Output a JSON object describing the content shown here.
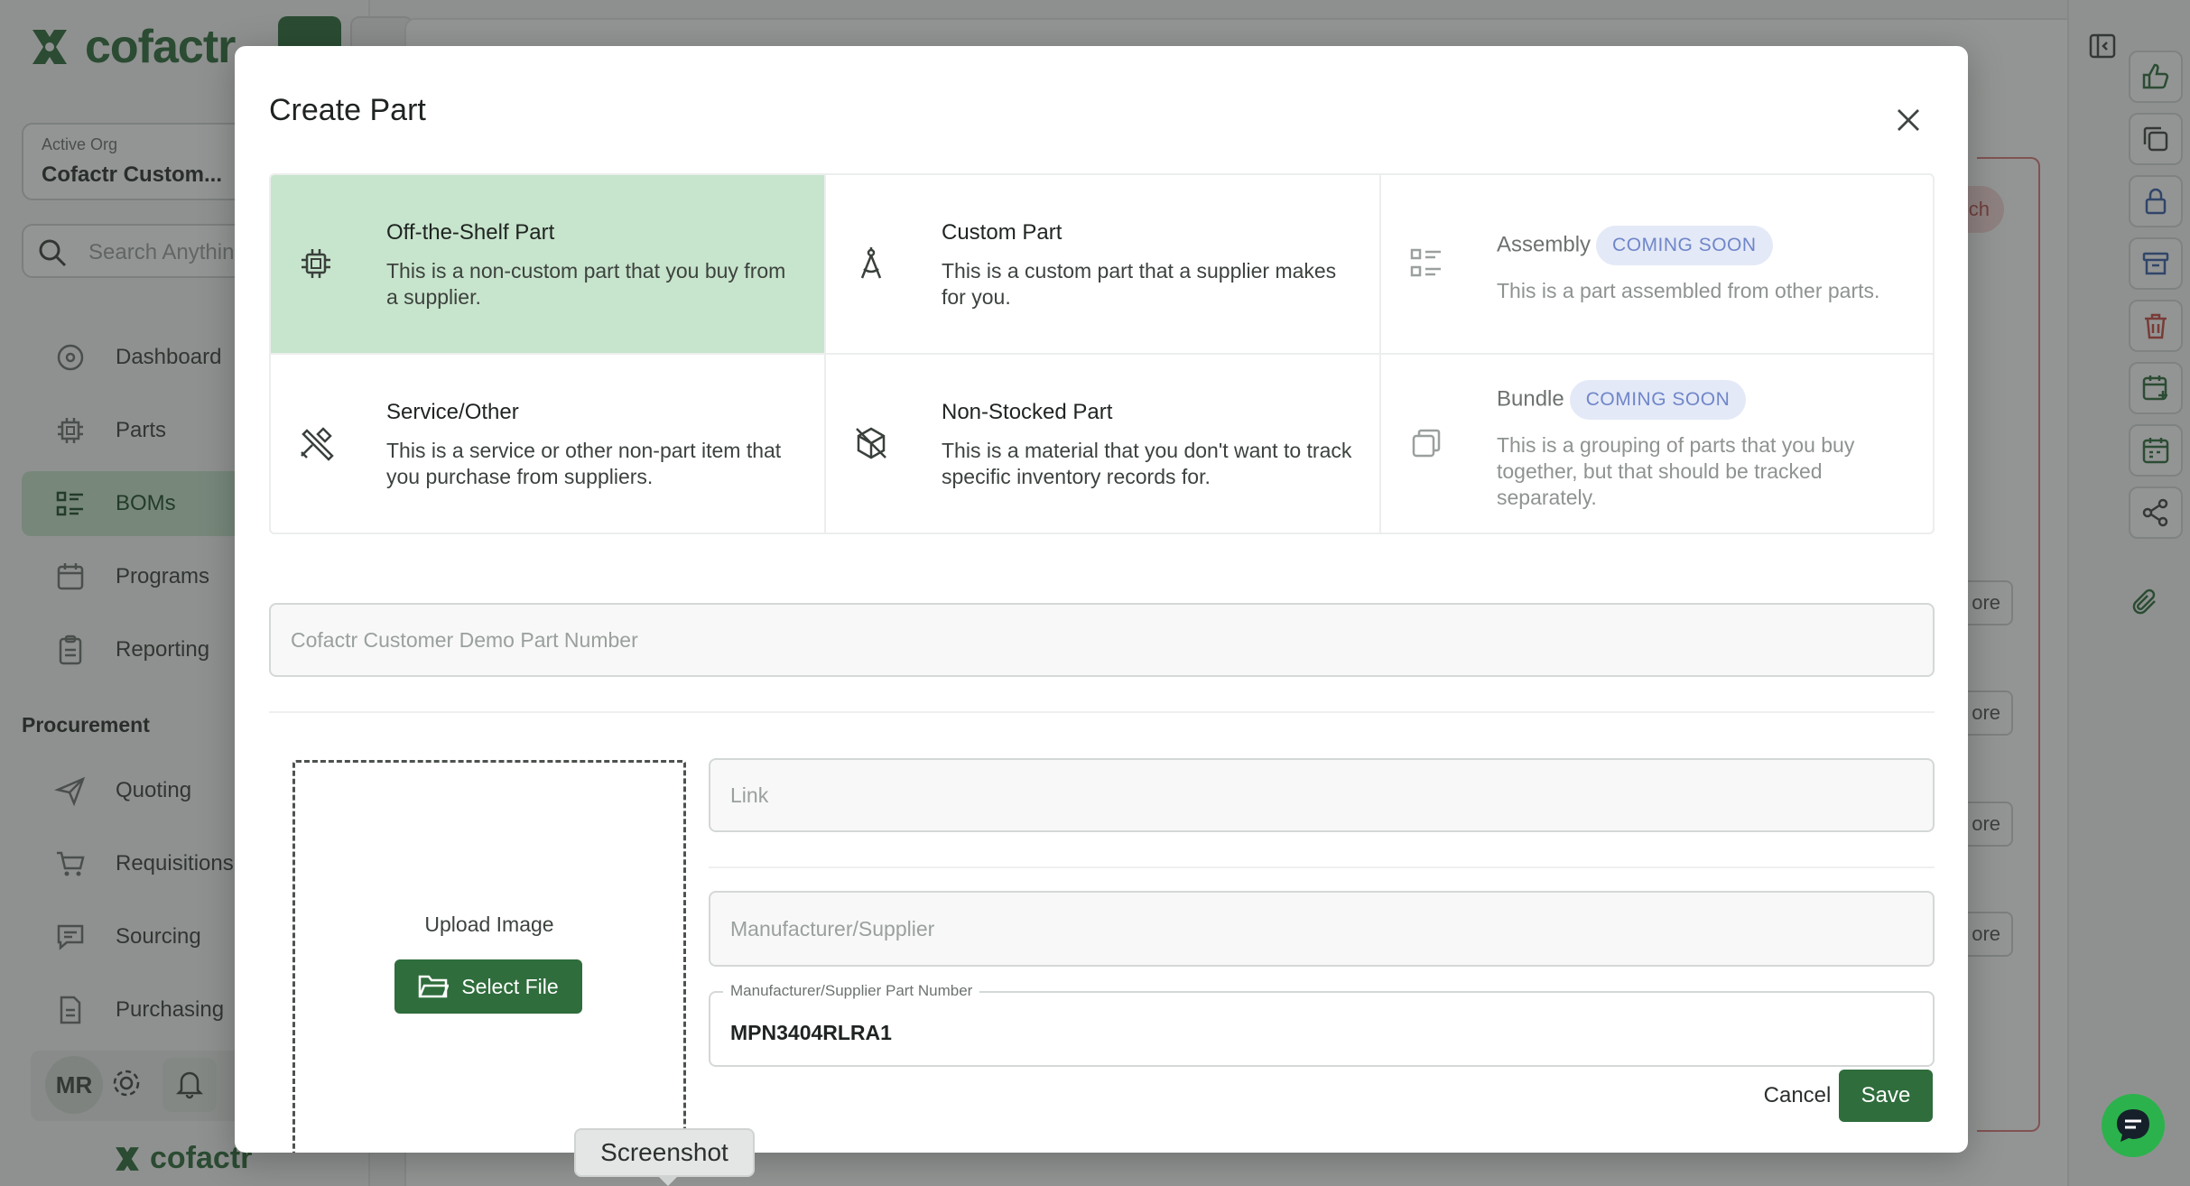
{
  "app": {
    "brand": "cofactr"
  },
  "sidebar": {
    "org_label": "Active Org",
    "org_value": "Cofactr Custom...",
    "search_placeholder": "Search Anythin",
    "nav": [
      {
        "label": "Dashboard",
        "icon": "dashboard-icon"
      },
      {
        "label": "Parts",
        "icon": "chip-icon"
      },
      {
        "label": "BOMs",
        "icon": "list-icon",
        "active": true
      },
      {
        "label": "Programs",
        "icon": "calendar-icon"
      },
      {
        "label": "Reporting",
        "icon": "clipboard-icon"
      }
    ],
    "section": "Procurement",
    "procurement": [
      {
        "label": "Quoting",
        "icon": "send-icon"
      },
      {
        "label": "Requisitions",
        "icon": "cart-icon"
      },
      {
        "label": "Sourcing",
        "icon": "chat-icon"
      },
      {
        "label": "Purchasing",
        "icon": "document-icon"
      }
    ],
    "avatar": "MR"
  },
  "background": {
    "pill_partial": "ch",
    "more_partial": "ore"
  },
  "modal": {
    "title": "Create Part",
    "part_types": [
      {
        "title": "Off-the-Shelf Part",
        "desc": "This is a non-custom part that you buy from a supplier.",
        "icon": "chip-icon",
        "selected": true
      },
      {
        "title": "Custom Part",
        "desc": "This is a custom part that a supplier makes for you.",
        "icon": "compass-icon"
      },
      {
        "title": "Assembly",
        "badge": "COMING SOON",
        "desc": "This is a part assembled from other parts.",
        "icon": "list-icon",
        "disabled": true
      },
      {
        "title": "Service/Other",
        "desc": "This is a service or other non-part item that you purchase from suppliers.",
        "icon": "tools-icon"
      },
      {
        "title": "Non-Stocked Part",
        "desc": "This is a material that you don't want to track specific inventory records for.",
        "icon": "box-off-icon"
      },
      {
        "title": "Bundle",
        "badge": "COMING SOON",
        "desc": "This is a grouping of parts that you buy together, but that should be tracked separately.",
        "icon": "copy-icon",
        "disabled": true
      }
    ],
    "part_number_placeholder": "Cofactr Customer Demo Part Number",
    "upload_label": "Upload Image",
    "select_file": "Select File",
    "link_placeholder": "Link",
    "manufacturer_placeholder": "Manufacturer/Supplier",
    "mpn_label": "Manufacturer/Supplier Part Number",
    "mpn_value": "MPN3404RLRA1",
    "cancel": "Cancel",
    "save": "Save"
  },
  "tooltip": "Screenshot",
  "colors": {
    "accent": "#2f6d3c",
    "selected_tile": "#c7e4cc",
    "badge_bg": "#e4e9f7",
    "badge_text": "#6f86c9"
  }
}
